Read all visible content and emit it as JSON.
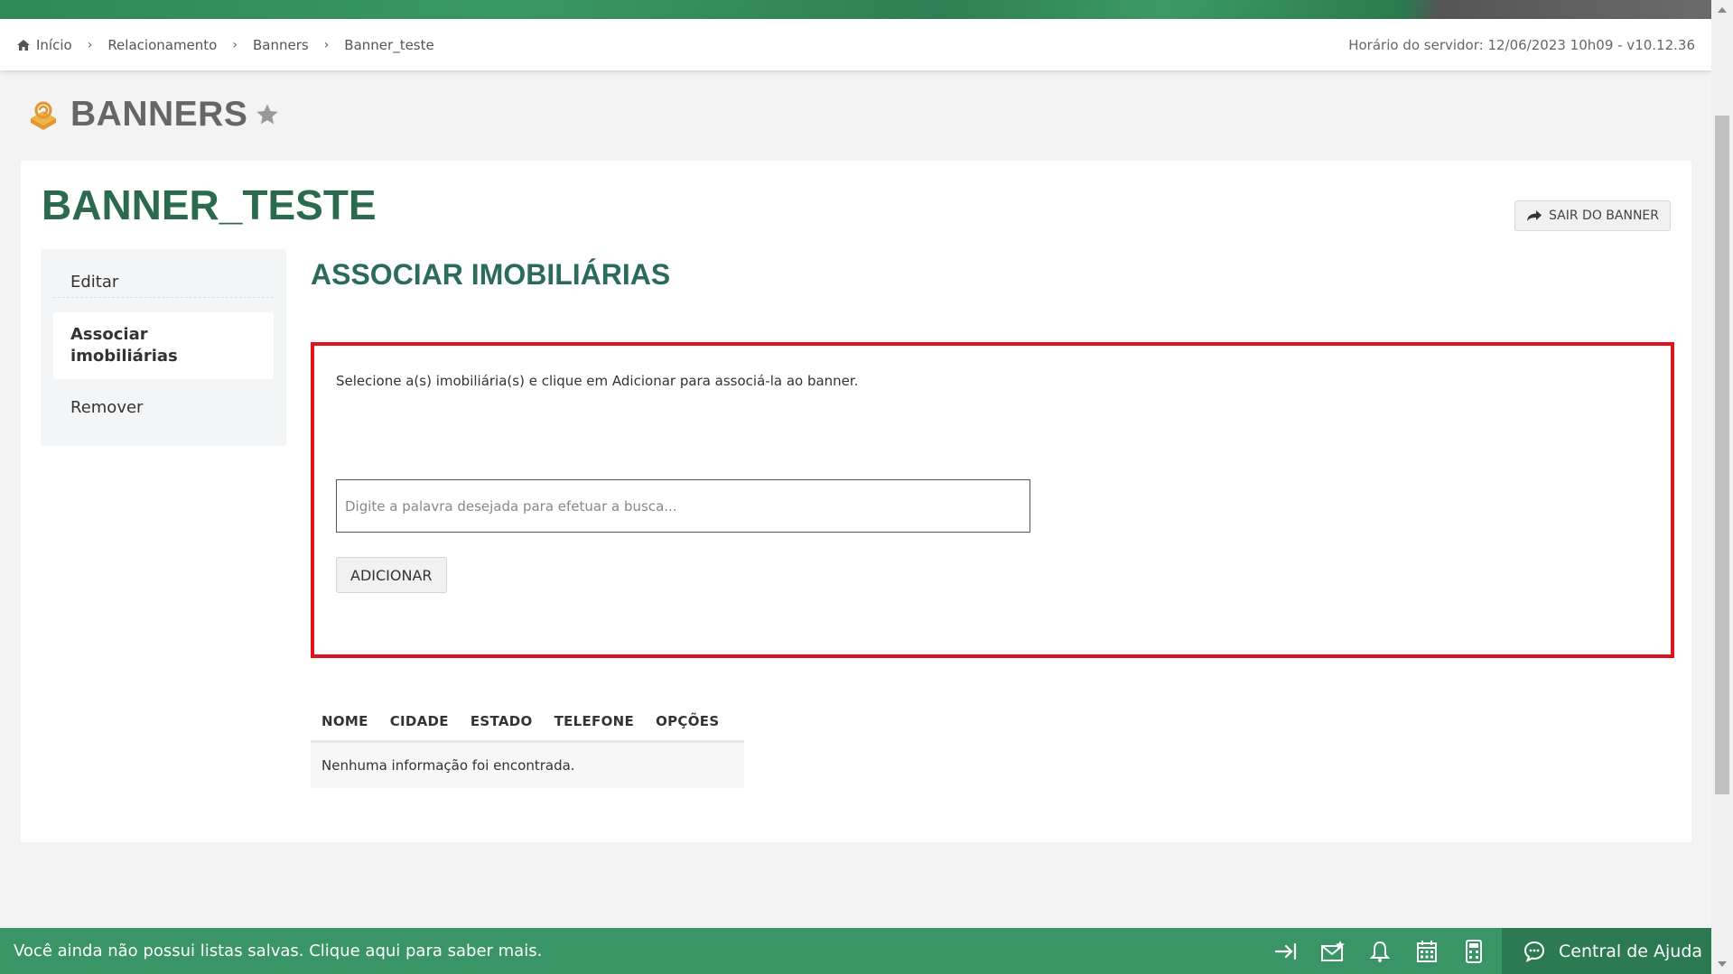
{
  "breadcrumb": {
    "items": [
      "Início",
      "Relacionamento",
      "Banners",
      "Banner_teste"
    ]
  },
  "server_time": "Horário do servidor: 12/06/2023 10h09 - v10.12.36",
  "page": {
    "title": "BANNERS",
    "banner_name": "BANNER_TESTE",
    "exit_button": "SAIR DO BANNER"
  },
  "sidenav": {
    "items": [
      "Editar",
      "Associar imobiliárias",
      "Remover"
    ]
  },
  "section": {
    "title": "ASSOCIAR IMOBILIÁRIAS",
    "instruction": "Selecione a(s) imobiliária(s) e clique em Adicionar para associá-la ao banner.",
    "search_placeholder": "Digite a palavra desejada para efetuar a busca...",
    "add_button": "ADICIONAR"
  },
  "table": {
    "headers": [
      "NOME",
      "CIDADE",
      "ESTADO",
      "TELEFONE",
      "OPÇÕES"
    ],
    "empty_message": "Nenhuma informação foi encontrada."
  },
  "footer": {
    "message": "Você ainda não possui listas salvas. Clique aqui para saber mais.",
    "help_label": "Central de Ajuda",
    "icons": [
      "login-arrow-icon",
      "mail-star-icon",
      "bell-icon",
      "calendar-icon",
      "calculator-icon"
    ]
  },
  "colors": {
    "brand_green": "#3a9566",
    "title_green": "#2b6a4e",
    "highlight_red": "#e1141c"
  }
}
